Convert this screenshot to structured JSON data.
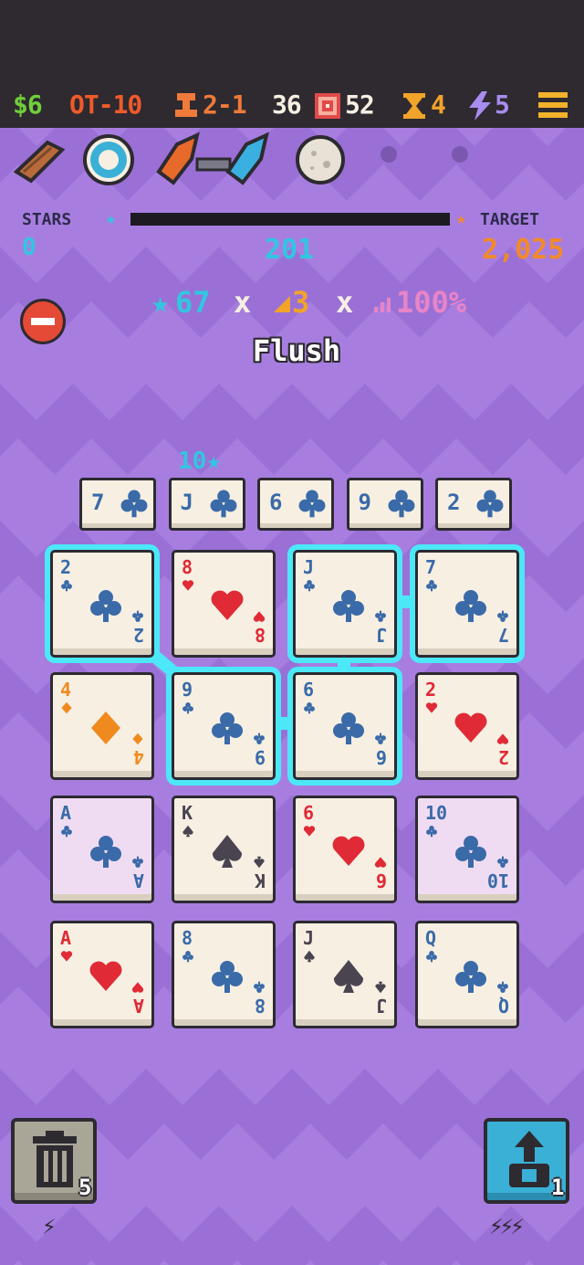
{
  "status": {
    "money": "$6",
    "round": "OT-10",
    "stage": "2-1",
    "deck": {
      "remaining": "36",
      "total": "52"
    },
    "hourglass": "4",
    "energy": "5"
  },
  "relics": [
    "wooden-plank-icon",
    "poker-chip-icon",
    "fire-ice-crystals-icon",
    "moon-stone-icon",
    "empty-slot",
    "empty-slot"
  ],
  "score": {
    "stars_label": "STARS",
    "stars_value": "0",
    "current": "201",
    "target_label": "TARGET",
    "target_value": "2,025",
    "progress": 0.0
  },
  "formula": {
    "stars": "67",
    "x1": "x",
    "mult": "3",
    "x2": "x",
    "percent": "100%"
  },
  "hand_name": "Flush",
  "bonus": "10",
  "played_hand": [
    {
      "rank": "7",
      "suit": "clubs"
    },
    {
      "rank": "J",
      "suit": "clubs"
    },
    {
      "rank": "6",
      "suit": "clubs"
    },
    {
      "rank": "9",
      "suit": "clubs"
    },
    {
      "rank": "2",
      "suit": "clubs"
    }
  ],
  "grid": [
    {
      "rank": "2",
      "suit": "clubs",
      "selected": true
    },
    {
      "rank": "8",
      "suit": "hearts",
      "selected": false
    },
    {
      "rank": "J",
      "suit": "clubs",
      "selected": true
    },
    {
      "rank": "7",
      "suit": "clubs",
      "selected": true
    },
    {
      "rank": "4",
      "suit": "diamonds",
      "selected": false
    },
    {
      "rank": "9",
      "suit": "clubs",
      "selected": true
    },
    {
      "rank": "6",
      "suit": "clubs",
      "selected": true
    },
    {
      "rank": "2",
      "suit": "hearts",
      "selected": false
    },
    {
      "rank": "A",
      "suit": "clubs",
      "selected": false,
      "foil": true
    },
    {
      "rank": "K",
      "suit": "spades",
      "selected": false
    },
    {
      "rank": "6",
      "suit": "hearts",
      "selected": false
    },
    {
      "rank": "10",
      "suit": "clubs",
      "selected": false,
      "foil": true
    },
    {
      "rank": "A",
      "suit": "hearts",
      "selected": false
    },
    {
      "rank": "8",
      "suit": "clubs",
      "selected": false
    },
    {
      "rank": "J",
      "suit": "spades",
      "selected": false
    },
    {
      "rank": "Q",
      "suit": "clubs",
      "selected": false
    }
  ],
  "buttons": {
    "discard_count": "5",
    "discard_cost": "⚡",
    "boost_count": "1",
    "boost_cost": "⚡⚡⚡"
  },
  "colors": {
    "clubs": "#3a6aa8",
    "hearts": "#e02a36",
    "diamonds": "#f08a1e",
    "spades": "#4a4450",
    "selection": "#4ce8f8",
    "background": "#a77ee0"
  }
}
